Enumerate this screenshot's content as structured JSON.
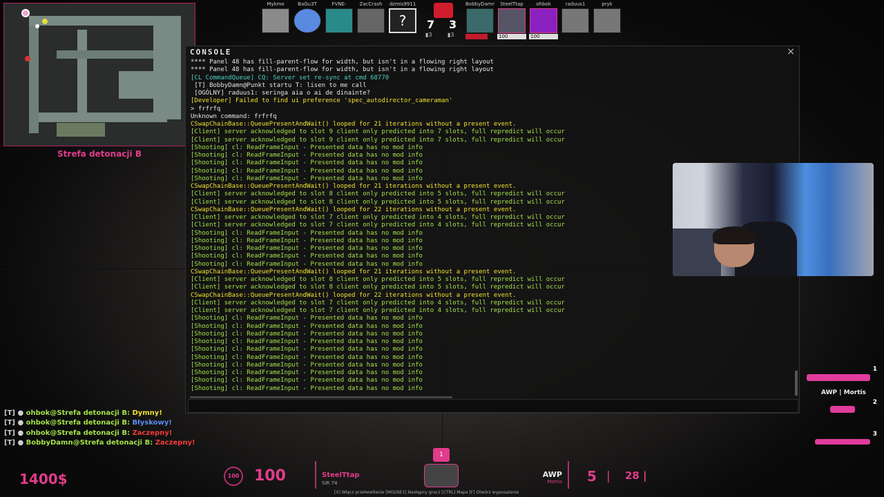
{
  "radar": {
    "location_label": "Strefa detonacji B"
  },
  "scoreboard": {
    "ct_score": "7",
    "t_score": "3",
    "ct_sub": "▮3",
    "t_sub": "▮3",
    "players_left": [
      {
        "name": "Mykmo",
        "hp": ""
      },
      {
        "name": "BaGu3T",
        "hp": ""
      },
      {
        "name": "FVNE-",
        "hp": ""
      },
      {
        "name": "ZacCrash",
        "hp": ""
      },
      {
        "name": "dzmis9911",
        "hp": ""
      }
    ],
    "players_right": [
      {
        "name": "BobbyDamn",
        "hp": ""
      },
      {
        "name": "SteelTtap",
        "hp": "100"
      },
      {
        "name": "ohbok",
        "hp": "100"
      },
      {
        "name": "raduus1",
        "hp": ""
      },
      {
        "name": "pryk",
        "hp": ""
      }
    ]
  },
  "console": {
    "title": "CONSOLE",
    "close_label": "×",
    "input_value": "",
    "lines": [
      {
        "text": "**** Panel 48 has fill-parent-flow for width, but isn't in a flowing right layout",
        "color": "#e6e6e6"
      },
      {
        "text": "**** Panel 48 has fill-parent-flow for width, but isn't in a flowing right layout",
        "color": "#e6e6e6"
      },
      {
        "text": "[CL CommandQueue] CQ: Server set re-sync at cmd 68770",
        "color": "#4fd1c5"
      },
      {
        "text": " [T] BobbyDamn@Punkt startu T: lisen to me call",
        "color": "#e6e6e6"
      },
      {
        "text": " [OGÓLNY] raduus1: seringa aia o ai de dinainte?",
        "color": "#e6e6e6"
      },
      {
        "text": "[Developer] Failed to find ui preference 'spec_autodirector_cameraman'",
        "color": "#f0e030"
      },
      {
        "text": "> frfrfq",
        "color": "#e6e6e6"
      },
      {
        "text": "Unknown command: frfrfq",
        "color": "#e6e6e6"
      },
      {
        "text": "CSwapChainBase::QueuePresentAndWait() looped for 21 iterations without a present event.",
        "color": "#f0e030"
      },
      {
        "text": "[Client] server acknowledged to slot 9 client only predicted into 7 slots, full repredict will occur",
        "color": "#a4e04a"
      },
      {
        "text": "[Client] server acknowledged to slot 9 client only predicted into 7 slots, full repredict will occur",
        "color": "#a4e04a"
      },
      {
        "text": "[Shooting] cl: ReadFrameInput - Presented data has no mod info",
        "color": "#a4e04a"
      },
      {
        "text": "[Shooting] cl: ReadFrameInput - Presented data has no mod info",
        "color": "#a4e04a"
      },
      {
        "text": "[Shooting] cl: ReadFrameInput - Presented data has no mod info",
        "color": "#a4e04a"
      },
      {
        "text": "[Shooting] cl: ReadFrameInput - Presented data has no mod info",
        "color": "#a4e04a"
      },
      {
        "text": "[Shooting] cl: ReadFrameInput - Presented data has no mod info",
        "color": "#a4e04a"
      },
      {
        "text": "CSwapChainBase::QueuePresentAndWait() looped for 21 iterations without a present event.",
        "color": "#f0e030"
      },
      {
        "text": "[Client] server acknowledged to slot 8 client only predicted into 5 slots, full repredict will occur",
        "color": "#a4e04a"
      },
      {
        "text": "[Client] server acknowledged to slot 8 client only predicted into 5 slots, full repredict will occur",
        "color": "#a4e04a"
      },
      {
        "text": "CSwapChainBase::QueuePresentAndWait() looped for 22 iterations without a present event.",
        "color": "#f0e030"
      },
      {
        "text": "[Client] server acknowledged to slot 7 client only predicted into 4 slots, full repredict will occur",
        "color": "#a4e04a"
      },
      {
        "text": "[Client] server acknowledged to slot 7 client only predicted into 4 slots, full repredict will occur",
        "color": "#a4e04a"
      },
      {
        "text": "[Shooting] cl: ReadFrameInput - Presented data has no mod info",
        "color": "#a4e04a"
      },
      {
        "text": "[Shooting] cl: ReadFrameInput - Presented data has no mod info",
        "color": "#a4e04a"
      },
      {
        "text": "[Shooting] cl: ReadFrameInput - Presented data has no mod info",
        "color": "#a4e04a"
      },
      {
        "text": "[Shooting] cl: ReadFrameInput - Presented data has no mod info",
        "color": "#a4e04a"
      },
      {
        "text": "[Shooting] cl: ReadFrameInput - Presented data has no mod info",
        "color": "#a4e04a"
      },
      {
        "text": "CSwapChainBase::QueuePresentAndWait() looped for 21 iterations without a present event.",
        "color": "#f0e030"
      },
      {
        "text": "[Client] server acknowledged to slot 8 client only predicted into 5 slots, full repredict will occur",
        "color": "#a4e04a"
      },
      {
        "text": "[Client] server acknowledged to slot 8 client only predicted into 5 slots, full repredict will occur",
        "color": "#a4e04a"
      },
      {
        "text": "CSwapChainBase::QueuePresentAndWait() looped for 22 iterations without a present event.",
        "color": "#f0e030"
      },
      {
        "text": "[Client] server acknowledged to slot 7 client only predicted into 4 slots, full repredict will occur",
        "color": "#a4e04a"
      },
      {
        "text": "[Client] server acknowledged to slot 7 client only predicted into 4 slots, full repredict will occur",
        "color": "#a4e04a"
      },
      {
        "text": "[Shooting] cl: ReadFrameInput - Presented data has no mod info",
        "color": "#a4e04a"
      },
      {
        "text": "[Shooting] cl: ReadFrameInput - Presented data has no mod info",
        "color": "#a4e04a"
      },
      {
        "text": "[Shooting] cl: ReadFrameInput - Presented data has no mod info",
        "color": "#a4e04a"
      },
      {
        "text": "[Shooting] cl: ReadFrameInput - Presented data has no mod info",
        "color": "#a4e04a"
      },
      {
        "text": "[Shooting] cl: ReadFrameInput - Presented data has no mod info",
        "color": "#a4e04a"
      },
      {
        "text": "[Shooting] cl: ReadFrameInput - Presented data has no mod info",
        "color": "#a4e04a"
      },
      {
        "text": "[Shooting] cl: ReadFrameInput - Presented data has no mod info",
        "color": "#a4e04a"
      },
      {
        "text": "[Shooting] cl: ReadFrameInput - Presented data has no mod info",
        "color": "#a4e04a"
      },
      {
        "text": "[Shooting] cl: ReadFrameInput - Presented data has no mod info",
        "color": "#a4e04a"
      },
      {
        "text": "[Shooting] cl: ReadFrameInput - Presented data has no mod info",
        "color": "#a4e04a"
      }
    ]
  },
  "chat": [
    {
      "team": "[T] ●",
      "name": "ohbok",
      "loc": "@Strefa detonacji B:",
      "msg": "Dymny!",
      "msg_color": "yellow"
    },
    {
      "team": "[T] ●",
      "name": "ohbok",
      "loc": "@Strefa detonacji B:",
      "msg": "Błyskowy!",
      "msg_color": "blue"
    },
    {
      "team": "[T] ●",
      "name": "ohbok",
      "loc": "@Strefa detonacji B:",
      "msg": "Zaczepny!",
      "msg_color": "red"
    },
    {
      "team": "[T] ●",
      "name": "BobbyDamn",
      "loc": "@Strefa detonacji B:",
      "msg": "Zaczepny!",
      "msg_color": "red"
    }
  ],
  "weapons": {
    "slot1": "1",
    "slot2": "2",
    "slot3": "3",
    "primary_name": "AWP | Mortis"
  },
  "hud": {
    "money": "1400$",
    "armor_icon": "100",
    "health": "100",
    "spectating_name": "SteelTtap",
    "spectating_sub": "SIR 74",
    "spec_badge": "1",
    "weapon_name": "AWP",
    "weapon_skin": "Mortis",
    "ammo": "5",
    "ammo_sep": "|",
    "reserve": "28 |",
    "hints": "[X] Włącz przełwietlenie   [MOUSE1] Następny gracz   [CTRL] Mapa   [F] Otwórz wyposażenie"
  },
  "colors": {
    "accent": "#e03c8c",
    "console_green": "#a4e04a",
    "console_yellow": "#f0e030",
    "console_cyan": "#4fd1c5"
  }
}
